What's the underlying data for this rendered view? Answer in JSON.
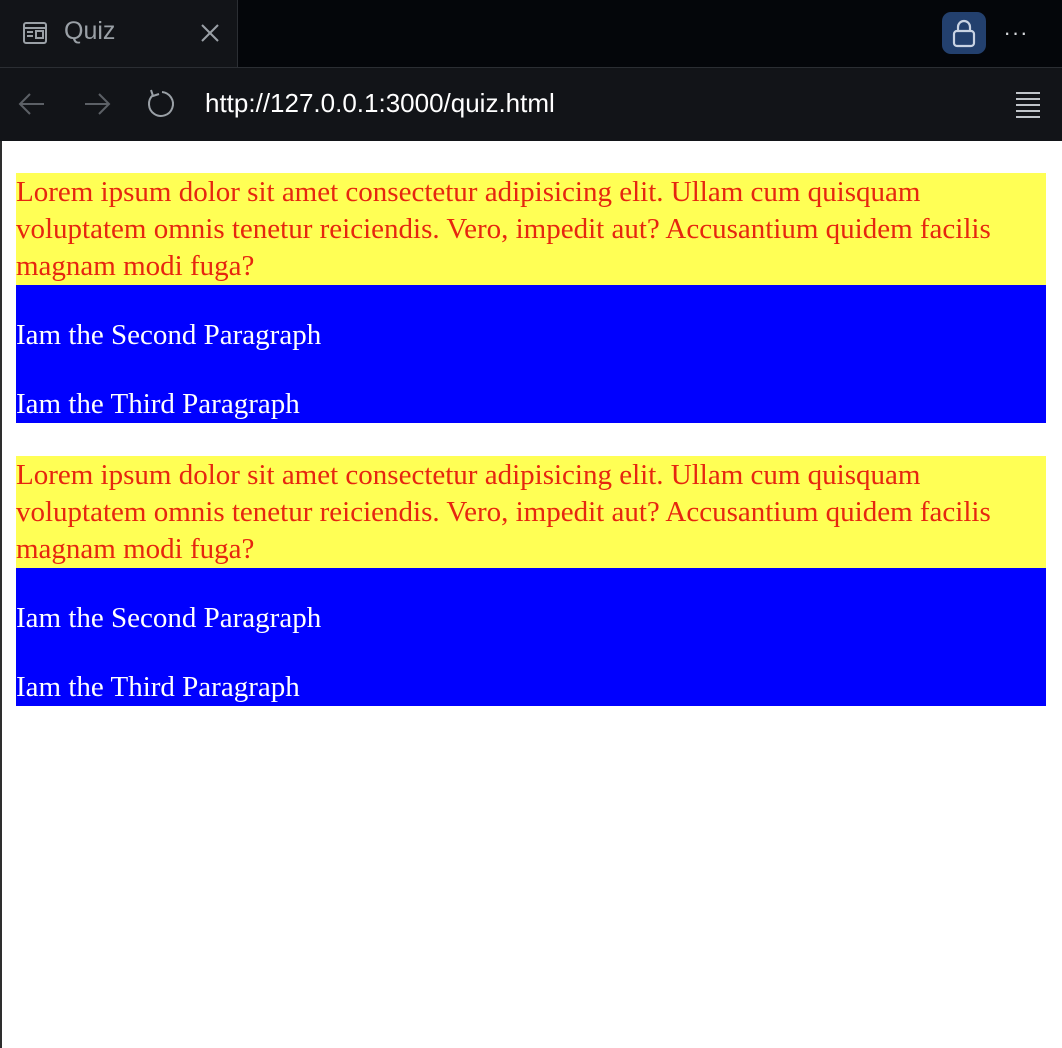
{
  "browser": {
    "tab_title": "Quiz",
    "url": "http://127.0.0.1:3000/quiz.html",
    "more_label": "···"
  },
  "sections": [
    {
      "lorem": "Lorem ipsum dolor sit amet consectetur adipisicing elit. Ullam cum quisquam voluptatem omnis tenetur reiciendis. Vero, impedit aut? Accusantium quidem facilis magnam modi fuga?",
      "second": "Iam the Second Paragraph",
      "third": "Iam the Third Paragraph"
    },
    {
      "lorem": "Lorem ipsum dolor sit amet consectetur adipisicing elit. Ullam cum quisquam voluptatem omnis tenetur reiciendis. Vero, impedit aut? Accusantium quidem facilis magnam modi fuga?",
      "second": "Iam the Second Paragraph",
      "third": "Iam the Third Paragraph"
    }
  ],
  "colors": {
    "yellow_bg": "#ffff55",
    "red_text": "#e6260f",
    "blue_bg": "#0000ff"
  }
}
